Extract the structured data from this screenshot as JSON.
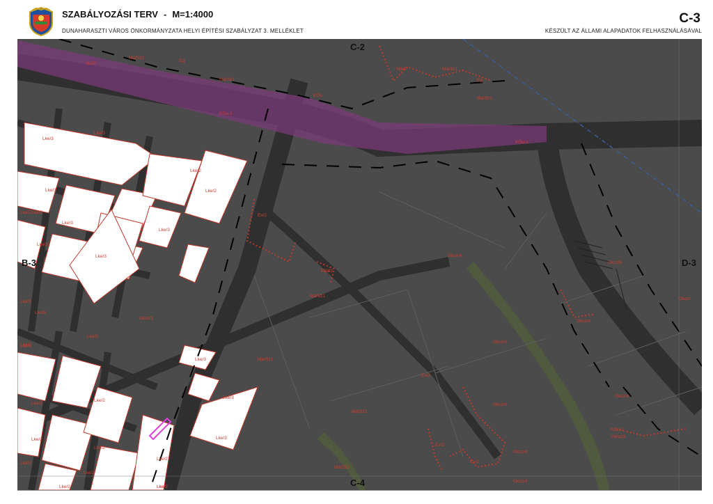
{
  "header": {
    "plan_title": "SZABÁLYOZÁSI TERV",
    "separator": "-",
    "scale": "M=1:4000",
    "subtitle": "DUNAHARASZTI VÁROS ÖNKORMÁNYZATA HELYI ÉPÍTÉSI SZABÁLYZAT 3. MELLÉKLET",
    "sheet_id": "C-3",
    "source_note": "KÉSZÜLT AZ ÁLLAMI ALAPADATOK FELHASZNÁLÁSÁVAL"
  },
  "neighbors": {
    "north": "C-2",
    "south": "C-4",
    "west": "B-3",
    "east": "D-3"
  },
  "zone_labels": [
    "Má/P",
    "Má/Sz1",
    "Eg",
    "Má/Sz1",
    "Má/P",
    "Má/Sz1",
    "Eg",
    "Má/Sz1",
    "KÖu",
    "KÖu-1",
    "KÖu-1",
    "Lke/3",
    "Lke/3",
    "Lke/2",
    "Lke/2",
    "Lke/3",
    "Lke/2",
    "Lke/3",
    "Lke/3",
    "Lke/3",
    "Lke/3",
    "Lke/2",
    "Ev/2",
    "Ev/2",
    "Gksz/4",
    "Gksz/5",
    "Lke/2",
    "Lke/5",
    "Lke/5",
    "Gksz/1",
    "Ev/1",
    "Má/Sz1",
    "Gksz/4",
    "Gksz/4",
    "Gksz/",
    "Lke/2",
    "Lke/3",
    "Lke/3",
    "Lke/2",
    "Má/Sz1",
    "Ev/2",
    "Lke/2",
    "Lke/2",
    "Lke/2",
    "Lke/2",
    "Lke/2",
    "Má/Sz1",
    "Gksz/4",
    "Gksz/4",
    "KÖu-1",
    "Ev/2",
    "Ev/2",
    "Gksz/3",
    "Lke/2",
    "Lke/2",
    "Lke/2",
    "Lke/2",
    "Má/Sz1",
    "Gksz/4",
    "Gksz/4",
    "Lke/3",
    "Lke/2"
  ],
  "colors": {
    "map_background": "#4b4b4b",
    "road": "#2f2f2f",
    "residential_block": "#ffffff",
    "zone_boundary": "#c0392b",
    "purple_corridor": "#7a3b78",
    "green_strip": "#4f5a3f",
    "dashed_line": "#000000"
  }
}
